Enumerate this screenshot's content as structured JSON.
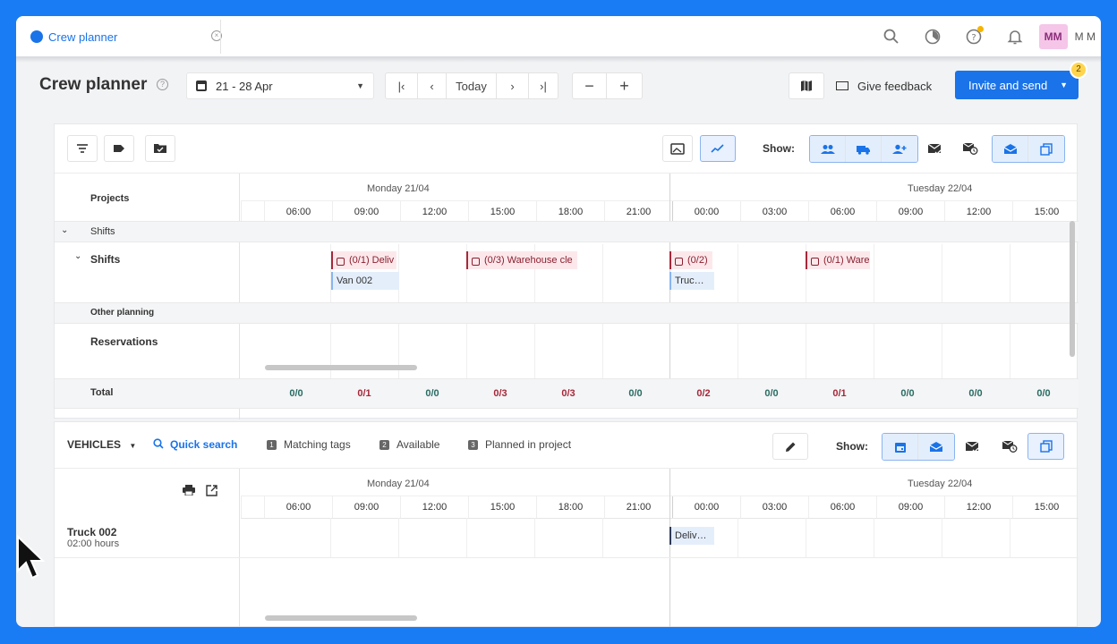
{
  "tab": {
    "label": "Crew planner"
  },
  "user": {
    "initials": "MM",
    "name": "M M"
  },
  "header": {
    "title": "Crew planner",
    "date_range": "21 - 28 Apr",
    "today": "Today",
    "feedback": "Give feedback",
    "invite": "Invite and send",
    "invite_badge": "2"
  },
  "planner": {
    "show_label": "Show:",
    "projects_label": "Projects",
    "day1": "Monday 21/04",
    "day2": "Tuesday 22/04",
    "hours": [
      "06:00",
      "09:00",
      "12:00",
      "15:00",
      "18:00",
      "21:00",
      "00:00",
      "03:00",
      "06:00",
      "09:00",
      "12:00",
      "15:00"
    ],
    "group_shifts": "Shifts",
    "row_shifts": "Shifts",
    "other_planning": "Other planning",
    "reservations": "Reservations",
    "total_label": "Total",
    "totals": [
      "0/0",
      "0/1",
      "0/0",
      "0/3",
      "0/3",
      "0/0",
      "0/2",
      "0/0",
      "0/1",
      "0/0",
      "0/0",
      "0/0"
    ],
    "shifts": [
      {
        "label": "(0/1) Deliv",
        "sub": "Van 002"
      },
      {
        "label": "(0/3) Warehouse cle"
      },
      {
        "label": "(0/2)",
        "sub": "Truc…"
      },
      {
        "label": "(0/1) Ware"
      }
    ]
  },
  "vehicles": {
    "title": "VEHICLES",
    "quick_search": "Quick search",
    "chips": [
      {
        "n": "1",
        "label": "Matching tags"
      },
      {
        "n": "2",
        "label": "Available"
      },
      {
        "n": "3",
        "label": "Planned in project"
      }
    ],
    "show_label": "Show:",
    "day1": "Monday 21/04",
    "day2": "Tuesday 22/04",
    "row": {
      "name": "Truck 002",
      "hours": "02:00 hours",
      "booking": "Deliv…"
    }
  },
  "colors": {
    "accent": "#1a73e8",
    "frame": "#1a7cf5",
    "shift_red": "#a5283a",
    "total_green": "#2a6c63"
  }
}
